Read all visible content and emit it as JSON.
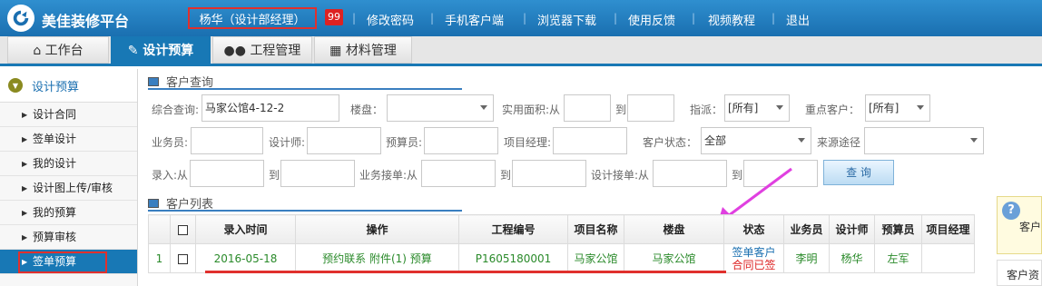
{
  "header": {
    "brand": "美佳装修平台",
    "user": "杨华（设计部经理）",
    "badge": "99",
    "nav": [
      "修改密码",
      "手机客户端",
      "浏览器下载",
      "使用反馈",
      "视频教程",
      "退出"
    ]
  },
  "tabs": [
    {
      "label": "工作台",
      "icon": "home-icon"
    },
    {
      "label": "设计预算",
      "icon": "edit-icon",
      "active": true
    },
    {
      "label": "工程管理",
      "icon": "users-icon"
    },
    {
      "label": "材料管理",
      "icon": "grid-icon"
    }
  ],
  "sidebar": {
    "title": "设计预算",
    "items": [
      "设计合同",
      "签单设计",
      "我的设计",
      "设计图上传/审核",
      "我的预算",
      "预算审核",
      "签单预算"
    ],
    "active": "签单预算"
  },
  "query": {
    "section_title": "客户查询",
    "labels": {
      "composite": "综合查询:",
      "estate": "楼盘：",
      "area_from": "实用面积:从",
      "to": "到",
      "assign": "指派：",
      "key_customer": "重点客户：",
      "salesman": "业务员:",
      "designer": "设计师:",
      "budgeter": "预算员:",
      "pm": "项目经理:",
      "status": "客户状态：",
      "source": "来源途径",
      "entry_from": "录入:从",
      "biz_from": "业务接单:从",
      "design_from": "设计接单:从"
    },
    "values": {
      "composite": "马家公馆4-12-2",
      "assign": "[所有]",
      "key_customer": "[所有]",
      "status": "全部"
    },
    "button": "查 询"
  },
  "list": {
    "section_title": "客户列表",
    "columns": [
      "",
      "",
      "录入时间",
      "操作",
      "工程编号",
      "项目名称",
      "楼盘",
      "状态",
      "业务员",
      "设计师",
      "预算员",
      "项目经理"
    ],
    "rows": [
      {
        "index": "1",
        "date": "2016-05-18",
        "actions": "预约联系 附件(1) 预算",
        "code": "P1605180001",
        "project": "马家公馆",
        "estate": "马家公馆",
        "status1": "签单客户",
        "status2": "合同已签",
        "salesman": "李明",
        "designer": "杨华",
        "budgeter": "左军",
        "pm": ""
      }
    ]
  },
  "right_panel": {
    "text1": "客户",
    "text2": "客户资"
  }
}
